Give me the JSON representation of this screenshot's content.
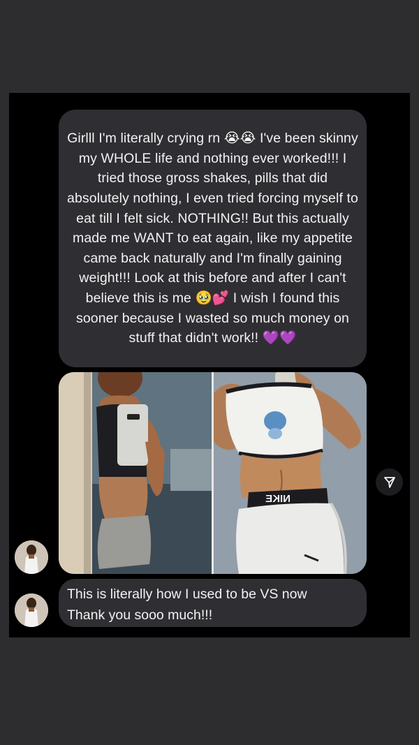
{
  "conversation": {
    "message_1": {
      "text": "Girlll I'm literally crying rn 😭😭 I've been skinny my WHOLE life and nothing ever worked!!! I tried those gross shakes, pills that did absolutely nothing, I even tried forcing myself to eat till I felt sick. NOTHING!! But this actually made me WANT to eat again, like my appetite came back naturally and I'm finally gaining weight!!! Look at this before and after I can't believe this is me 🥹💕 I wish I found this sooner because I wasted so much money on stuff that didn't work!! 💜💜"
    },
    "photo": {
      "left_shirt_text": "",
      "right_waistband_text": "NIKE"
    },
    "message_2": {
      "line_1": "This is literally how I used to be VS now",
      "line_2": "Thank you sooo much!!!"
    }
  },
  "colors": {
    "page_background": "#2d2d30",
    "panel_background": "#000000",
    "bubble_background": "#2f2f33",
    "text": "#f2f2f2"
  },
  "icons": {
    "share": "send-icon",
    "avatar": "avatar"
  }
}
